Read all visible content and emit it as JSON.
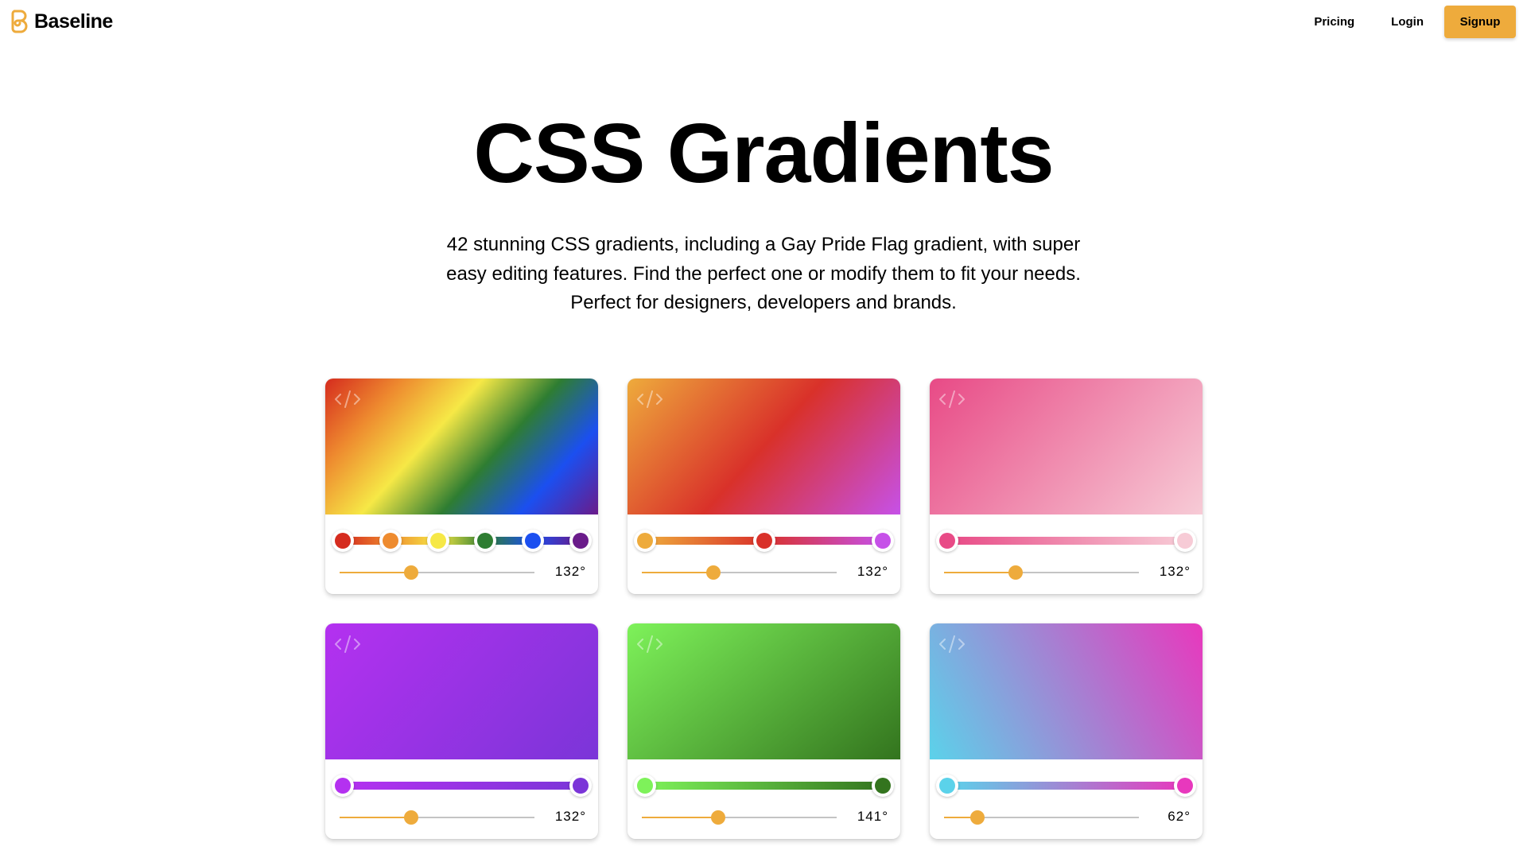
{
  "header": {
    "logo_text": "Baseline",
    "logo_icon": "baseline-logo-icon",
    "nav": {
      "pricing": "Pricing",
      "login": "Login",
      "signup": "Signup"
    },
    "accent_color": "#eeab3c"
  },
  "hero": {
    "title": "CSS Gradients",
    "subtitle_lines": [
      "42 stunning CSS gradients, including a Gay Pride Flag gradient, with super",
      "easy editing features. Find the perfect one or modify them to fit your needs.",
      "Perfect for designers, developers and brands."
    ]
  },
  "gradients": [
    {
      "name": "pride-flag",
      "angle": 132,
      "angle_label": "132°",
      "stops": [
        "#d52b1e",
        "#ee8b2f",
        "#f6e846",
        "#2e7d32",
        "#1b4ff0",
        "#6a1b8a"
      ]
    },
    {
      "name": "orange-red-purple",
      "angle": 132,
      "angle_label": "132°",
      "stops": [
        "#eeab3c",
        "#d9312a",
        "#c651e8"
      ]
    },
    {
      "name": "pink-fade",
      "angle": 132,
      "angle_label": "132°",
      "stops": [
        "#e84a86",
        "#f7cbd6"
      ]
    },
    {
      "name": "violet",
      "angle": 132,
      "angle_label": "132°",
      "stops": [
        "#b431f0",
        "#7b35d8"
      ]
    },
    {
      "name": "green",
      "angle": 141,
      "angle_label": "141°",
      "stops": [
        "#7ef25a",
        "#33741e"
      ]
    },
    {
      "name": "cyan-magenta",
      "angle": 62,
      "angle_label": "62°",
      "stops": [
        "#5bd2ea",
        "#e838bd"
      ]
    }
  ],
  "icons": {
    "card_code": "code-icon"
  }
}
